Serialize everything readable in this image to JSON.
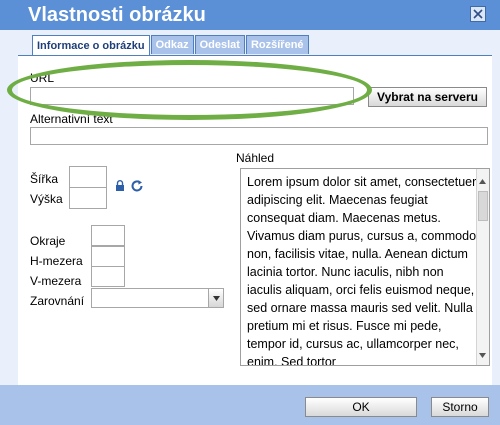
{
  "dialog": {
    "title": "Vlastnosti obrázku",
    "close_icon": "close-icon",
    "tabs": [
      {
        "label": "Informace o obrázku"
      },
      {
        "label": "Odkaz"
      },
      {
        "label": "Odeslat"
      },
      {
        "label": "Rozšířené"
      }
    ],
    "url_label": "URL",
    "url_value": "",
    "browse_server_label": "Vybrat na serveru",
    "alt_label": "Alternativní text",
    "alt_value": "",
    "width_label": "Šířka",
    "height_label": "Výška",
    "lock_icon": "lock-icon",
    "reset_icon": "reset-icon",
    "border_label": "Okraje",
    "hspace_label": "H-mezera",
    "vspace_label": "V-mezera",
    "align_label": "Zarovnání",
    "align_value": "",
    "preview_label": "Náhled",
    "preview_text": "Lorem ipsum dolor sit amet, consectetuer adipiscing elit. Maecenas feugiat consequat diam. Maecenas metus. Vivamus diam purus, cursus a, commodo non, facilisis vitae, nulla. Aenean dictum lacinia tortor. Nunc iaculis, nibh non iaculis aliquam, orci felis euismod neque, sed ornare massa mauris sed velit. Nulla pretium mi et risus. Fusce mi pede, tempor id, cursus ac, ullamcorper nec, enim. Sed tortor",
    "ok_label": "OK",
    "cancel_label": "Storno"
  },
  "colors": {
    "titlebar": "#5b8fd6",
    "panel_bg": "#e9f0fb",
    "tab_inactive": "#a9c2ea",
    "highlight_oval": "#6fae45"
  }
}
